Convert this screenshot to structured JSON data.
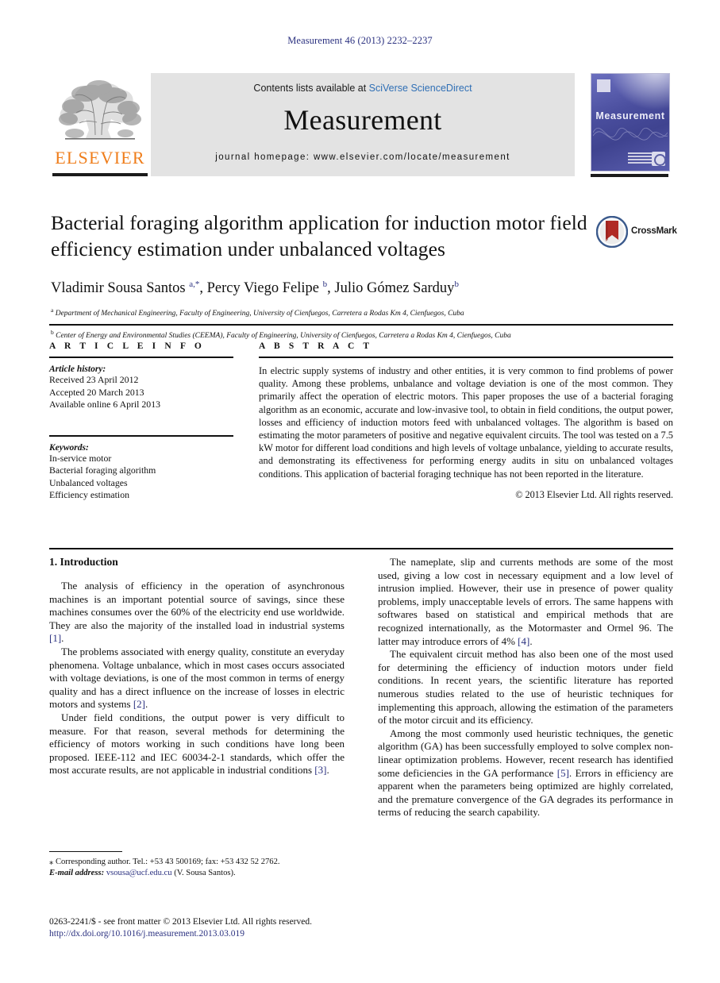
{
  "running_head": "Measurement 46 (2013) 2232–2237",
  "masthead": {
    "contents_prefix": "Contents lists available at ",
    "sciencedirect": "SciVerse ScienceDirect",
    "journal_title": "Measurement",
    "homepage": "journal homepage: www.elsevier.com/locate/measurement",
    "publisher_name": "ELSEVIER",
    "cover_title": "Measurement",
    "link_color": "#2f6fb5",
    "elsevier_orange": "#ef7d1a",
    "cover_blue": "#4a4e9e"
  },
  "article": {
    "title": "Bacterial foraging algorithm application for induction motor field efficiency estimation under unbalanced voltages",
    "authors_html": "Vladimir Sousa Santos <sup>a,*</sup>, Percy Viego Felipe <sup>b</sup>, Julio Gómez Sarduy<sup>b</sup>",
    "affiliation_a": "Department of Mechanical Engineering, Faculty of Engineering, University of Cienfuegos, Carretera a Rodas Km 4, Cienfuegos, Cuba",
    "affiliation_b": "Center of Energy and Environmental Studies (CEEMA), Faculty of Engineering, University of Cienfuegos, Carretera a Rodas Km 4, Cienfuegos, Cuba",
    "crossmark_label": "CrossMark"
  },
  "article_info": {
    "heading": "A R T I C L E    I N F O",
    "history_label": "Article history:",
    "history": [
      "Received 23 April 2012",
      "Accepted 20 March 2013",
      "Available online 6 April 2013"
    ],
    "keywords_label": "Keywords:",
    "keywords": [
      "In-service motor",
      "Bacterial foraging algorithm",
      "Unbalanced voltages",
      "Efficiency estimation"
    ]
  },
  "abstract": {
    "heading": "A B S T R A C T",
    "text": "In electric supply systems of industry and other entities, it is very common to find problems of power quality. Among these problems, unbalance and voltage deviation is one of the most common. They primarily affect the operation of electric motors. This paper proposes the use of a bacterial foraging algorithm as an economic, accurate and low-invasive tool, to obtain in field conditions, the output power, losses and efficiency of induction motors feed with unbalanced voltages. The algorithm is based on estimating the motor parameters of positive and negative equivalent circuits. The tool was tested on a 7.5 kW motor for different load conditions and high levels of voltage unbalance, yielding to accurate results, and demonstrating its effectiveness for performing energy audits in situ on unbalanced voltages conditions. This application of bacterial foraging technique has not been reported in the literature.",
    "copyright": "© 2013 Elsevier Ltd. All rights reserved."
  },
  "introduction": {
    "section_title": "1. Introduction",
    "left_paragraphs": [
      "The analysis of efficiency in the operation of asynchronous machines is an important potential source of savings, since these machines consumes over the 60% of the electricity end use worldwide. They are also the majority of the installed load in industrial systems [1].",
      "The problems associated with energy quality, constitute an everyday phenomena. Voltage unbalance, which in most cases occurs associated with voltage deviations, is one of the most common in terms of energy quality and has a direct influence on the increase of losses in electric motors and systems [2].",
      "Under field conditions, the output power is very difficult to measure. For that reason, several methods for determining the efficiency of motors working in such conditions have long been proposed. IEEE-112 and IEC 60034-2-1 standards, which offer the most accurate results, are not applicable in industrial conditions [3]."
    ],
    "right_paragraphs": [
      "The nameplate, slip and currents methods are some of the most used, giving a low cost in necessary equipment and a low level of intrusion implied. However, their use in presence of power quality problems, imply unacceptable levels of errors. The same happens with softwares based on statistical and empirical methods that are recognized internationally, as the Motormaster and Ormel 96. The latter may introduce errors of 4% [4].",
      "The equivalent circuit method has also been one of the most used for determining the efficiency of induction motors under field conditions. In recent years, the scientific literature has reported numerous studies related to the use of heuristic techniques for implementing this approach, allowing the estimation of the parameters of the motor circuit and its efficiency.",
      "Among the most commonly used heuristic techniques, the genetic algorithm (GA) has been successfully employed to solve complex non-linear optimization problems. However, recent research has identified some deficiencies in the GA performance [5]. Errors in efficiency are apparent when the parameters being optimized are highly correlated, and the premature convergence of the GA degrades its performance in terms of reducing the search capability."
    ]
  },
  "footnote": {
    "corresponding": "⁎ Corresponding author. Tel.: +53 43 500169; fax: +53 432 52 2762.",
    "email_label": "E-mail address:",
    "email": "vsousa@ucf.edu.cu",
    "email_owner": "(V. Sousa Santos)."
  },
  "bottom_matter": {
    "issn_line": "0263-2241/$ - see front matter © 2013 Elsevier Ltd. All rights reserved.",
    "doi_line": "http://dx.doi.org/10.1016/j.measurement.2013.03.019"
  }
}
